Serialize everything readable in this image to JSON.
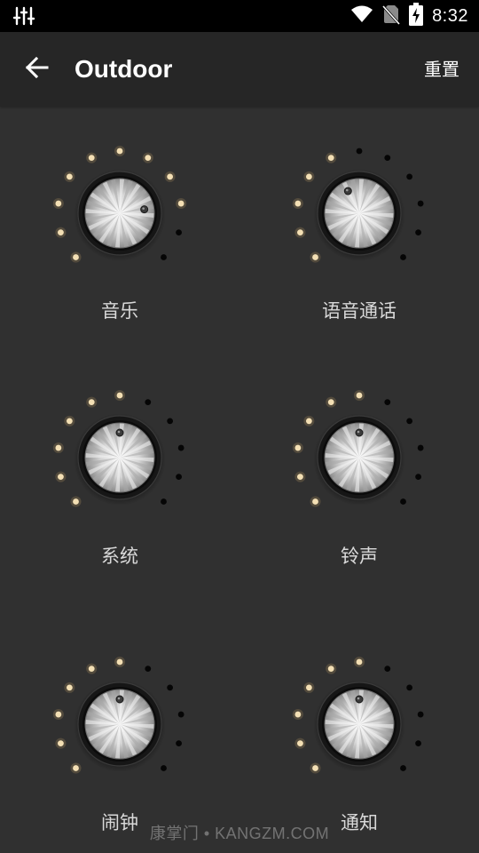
{
  "status_bar": {
    "time": "8:32",
    "icons": [
      "equalizer-icon",
      "wifi-icon",
      "no-sim-icon",
      "battery-charging-icon"
    ]
  },
  "app_bar": {
    "title": "Outdoor",
    "back_icon": "arrow-back-icon",
    "reset_label": "重置"
  },
  "knobs": [
    {
      "id": "music",
      "label": "音乐",
      "level": 0.8
    },
    {
      "id": "voice-call",
      "label": "语音通话",
      "level": 0.4
    },
    {
      "id": "system",
      "label": "系统",
      "level": 0.5
    },
    {
      "id": "ringtone",
      "label": "铃声",
      "level": 0.5
    },
    {
      "id": "alarm",
      "label": "闹钟",
      "level": 0.5
    },
    {
      "id": "notification",
      "label": "通知",
      "level": 0.5
    }
  ],
  "colors": {
    "active_dot": "#f3dfb4",
    "inactive_dot": "#050505",
    "background": "#303030",
    "app_bar": "#262626"
  },
  "watermark": "康掌门 • KANGZM.COM"
}
